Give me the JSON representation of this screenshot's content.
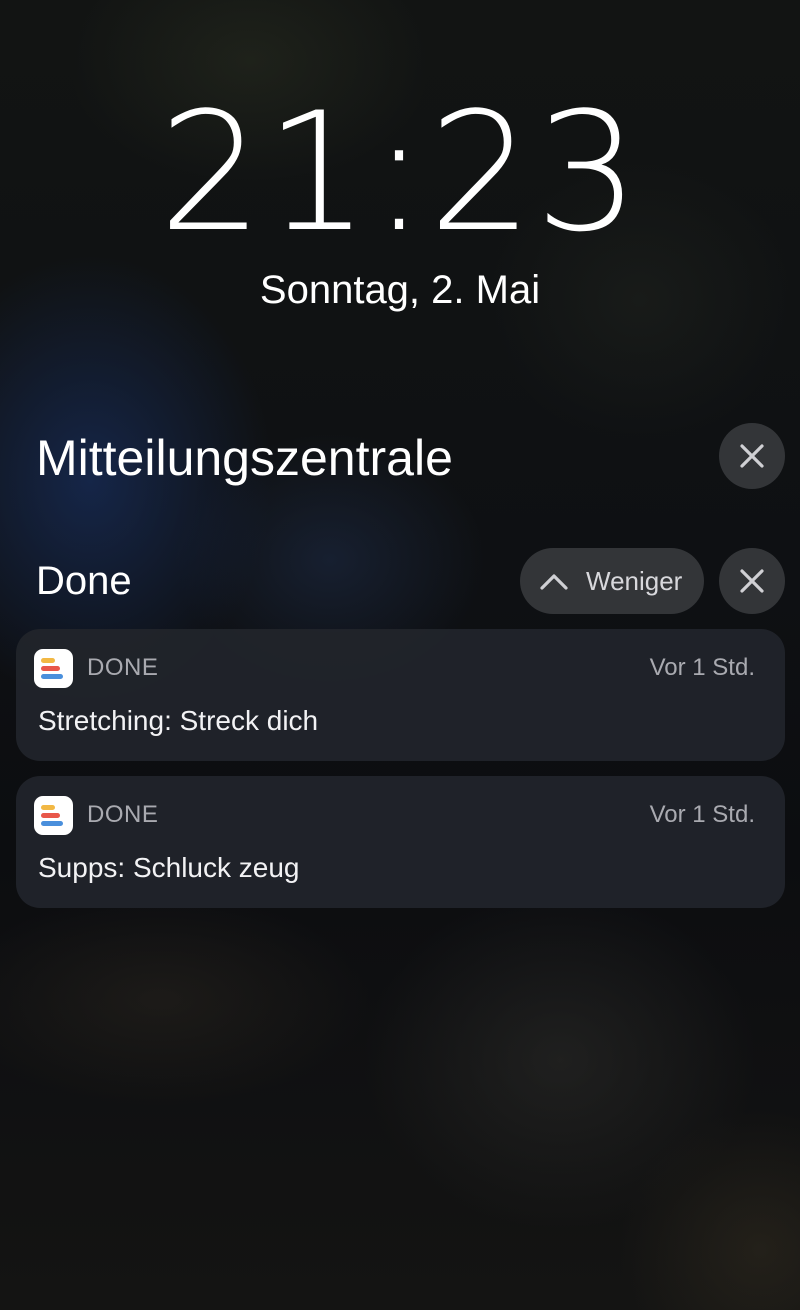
{
  "lock_screen": {
    "time": "21:23",
    "date": "Sonntag, 2. Mai"
  },
  "notification_center": {
    "title": "Mitteilungszentrale",
    "clear_icon": "close-icon"
  },
  "group": {
    "title": "Done",
    "collapse_label": "Weniger",
    "collapse_icon": "chevron-up-icon",
    "clear_icon": "close-icon"
  },
  "notifications": [
    {
      "app_name": "DONE",
      "time": "Vor 1 Std.",
      "message": "Stretching: Streck dich",
      "icon": "done-app-icon"
    },
    {
      "app_name": "DONE",
      "time": "Vor 1 Std.",
      "message": "Supps: Schluck zeug",
      "icon": "done-app-icon"
    }
  ],
  "colors": {
    "app_icon_bars": [
      "#f2b844",
      "#e8574a",
      "#4a8fdc"
    ],
    "card_background": "#21242a",
    "button_background": "#3a3c40"
  }
}
